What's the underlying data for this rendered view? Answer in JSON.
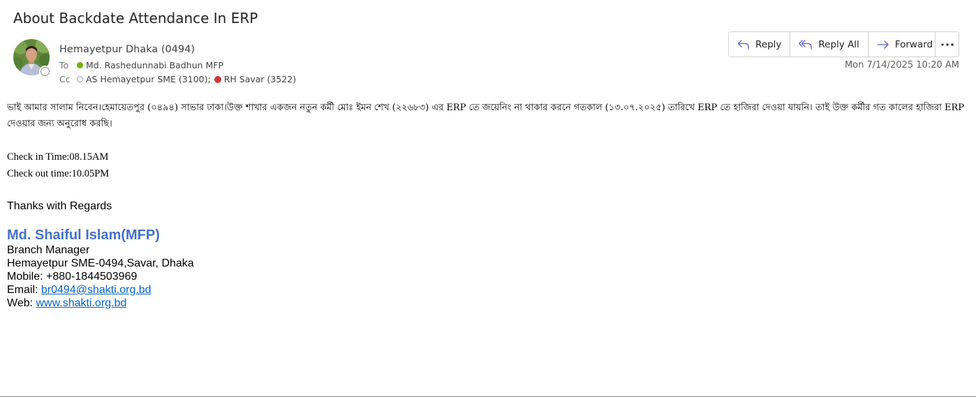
{
  "subject": "About Backdate Attendance In ERP",
  "sender": {
    "name": "Hemayetpur Dhaka (0494)",
    "presence": "offline"
  },
  "to": {
    "label": "To",
    "recipient": "Md. Rashedunnabi Badhun MFP",
    "status_color": "#6bb700"
  },
  "cc": {
    "label": "Cc",
    "recipients": [
      {
        "name": "AS Hemayetpur SME (3100);",
        "status": "offline"
      },
      {
        "name": "RH Savar (3522)",
        "status": "busy",
        "status_color": "#d13438"
      }
    ]
  },
  "toolbar": {
    "reply_label": "Reply",
    "reply_all_label": "Reply All",
    "forward_label": "Forward",
    "more_icon": "more-horizontal-icon"
  },
  "date": "Mon 7/14/2025 10:20 AM",
  "body": {
    "message": "ভাই আমার সালাম নিবেন।হেমায়েতপুর (০৪৯৪) সাভার ঢাকা।উক্ত শাখার একজন নতুন কর্মী  মোঃ ইমন শেখ (২২৬৮৩) এর ERP তে জয়েনিং না থাকার করনে গতকাল (১৩.০৭.২০২৫) তারিখে  ERP তে হাজিরা দেওয়া যায়নি। তাই উক্ত কর্মীর গত কালের হাজিরা ERP দেওয়ার জন্য অনুরোধ করছি।",
    "check_in": "Check in Time:08.15AM",
    "check_out": "Check out time:10.05PM",
    "closing": "Thanks with Regards"
  },
  "signature": {
    "name": "Md. Shaiful Islam(MFP)",
    "title": "Branch Manager",
    "branch": "Hemayetpur SME-0494,Savar, Dhaka",
    "mobile": "Mobile: +880-1844503969",
    "email_label": "Email: ",
    "email": "br0494@shakti.org.bd",
    "web_label": "Web: ",
    "web": "www.shakti.org.bd"
  },
  "colors": {
    "accent": "#4472c4",
    "link": "#0563c1"
  }
}
